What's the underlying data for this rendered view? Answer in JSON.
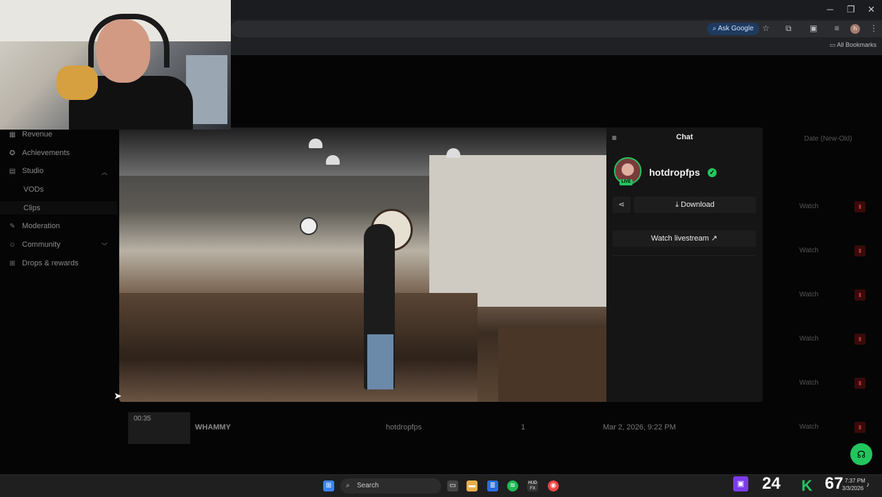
{
  "browser": {
    "ask_google": "Ask Google",
    "all_bookmarks": "All Bookmarks",
    "profile_initial": "h",
    "window_minimize": "─",
    "window_restore": "❐",
    "window_close": "✕"
  },
  "sidebar": {
    "items": [
      {
        "label": "Revenue",
        "icon": "revenue-icon"
      },
      {
        "label": "Achievements",
        "icon": "trophy-icon"
      },
      {
        "label": "Studio",
        "icon": "studio-icon"
      },
      {
        "label": "VODs"
      },
      {
        "label": "Clips"
      },
      {
        "label": "Moderation",
        "icon": "wrench-icon"
      },
      {
        "label": "Community",
        "icon": "community-icon"
      },
      {
        "label": "Drops & rewards",
        "icon": "gift-icon"
      }
    ]
  },
  "table": {
    "sort_label": "Date (New-Old)",
    "watch_label": "Watch",
    "last_row": {
      "duration": "00:35",
      "title": "WHAMMY",
      "channel": "hotdropfps",
      "count": "1",
      "date": "Mar 2, 2026, 9:22 PM",
      "action": "Watch"
    }
  },
  "chat_panel": {
    "title": "Chat",
    "channel_name": "hotdropfps",
    "live_badge": "LIVE",
    "download_label": "Download",
    "watch_livestream_label": "Watch livestream"
  },
  "taskbar": {
    "search_label": "Search",
    "stat_left": "24",
    "stat_right": "67",
    "clock_time": "7:37 PM",
    "clock_date": "3/3/2026",
    "hud_label": "HUD FX"
  },
  "colors": {
    "accent_green": "#22c55e",
    "twitch_purple": "#7c3aed",
    "delete_red": "#a33"
  }
}
